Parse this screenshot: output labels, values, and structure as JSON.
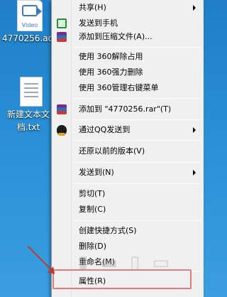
{
  "desktop": {
    "video_icon_label": "Video",
    "video_file_name": "4770256.ac",
    "text_file_name": "新建文本文档.txt"
  },
  "menu": {
    "items": [
      {
        "label": "共享(H)",
        "submenu": true
      },
      {
        "label": "发送到手机",
        "submenu": false
      },
      {
        "label": "添加到压缩文件(A)...",
        "submenu": false
      },
      {
        "label": "使用 360解除占用",
        "submenu": false
      },
      {
        "label": "使用 360强力删除",
        "submenu": false
      },
      {
        "label": "使用 360管理右键菜单",
        "submenu": false
      },
      {
        "label": "添加到 \"4770256.rar\"(T)",
        "submenu": false
      },
      {
        "label": "通过QQ发送到",
        "submenu": true
      },
      {
        "label": "还原以前的版本(V)",
        "submenu": false
      },
      {
        "label": "发送到(N)",
        "submenu": true
      },
      {
        "label": "剪切(T)",
        "submenu": false
      },
      {
        "label": "复制(C)",
        "submenu": false
      },
      {
        "label": "创建快捷方式(S)",
        "submenu": false
      },
      {
        "label": "删除(D)",
        "submenu": false
      },
      {
        "label": "重命名(M)",
        "submenu": false
      },
      {
        "label": "属性(R)",
        "submenu": false
      }
    ]
  },
  "colors": {
    "desktop_bg": "#2a8fd6",
    "menu_bg": "#f0f0f0",
    "highlight_border": "#e57a7a",
    "annotation_arrow": "#c0392b"
  }
}
